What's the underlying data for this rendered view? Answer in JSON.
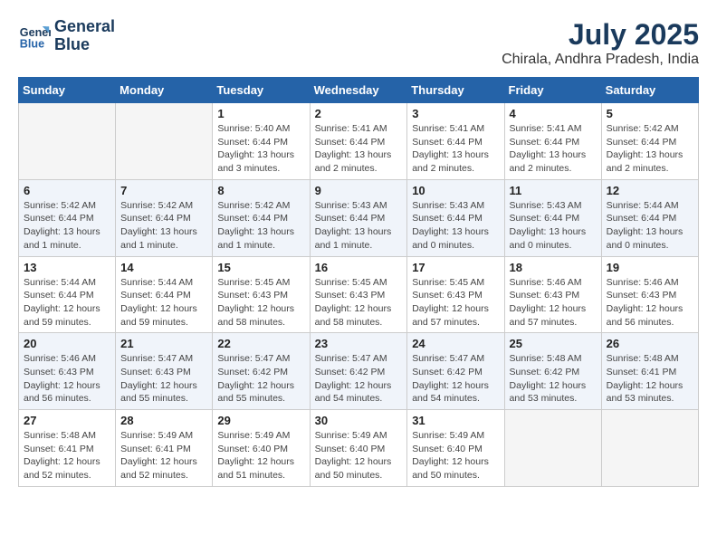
{
  "header": {
    "logo_line1": "General",
    "logo_line2": "Blue",
    "month_year": "July 2025",
    "location": "Chirala, Andhra Pradesh, India"
  },
  "weekdays": [
    "Sunday",
    "Monday",
    "Tuesday",
    "Wednesday",
    "Thursday",
    "Friday",
    "Saturday"
  ],
  "weeks": [
    [
      {
        "day": "",
        "empty": true
      },
      {
        "day": "",
        "empty": true
      },
      {
        "day": "1",
        "info": "Sunrise: 5:40 AM\nSunset: 6:44 PM\nDaylight: 13 hours and 3 minutes."
      },
      {
        "day": "2",
        "info": "Sunrise: 5:41 AM\nSunset: 6:44 PM\nDaylight: 13 hours and 2 minutes."
      },
      {
        "day": "3",
        "info": "Sunrise: 5:41 AM\nSunset: 6:44 PM\nDaylight: 13 hours and 2 minutes."
      },
      {
        "day": "4",
        "info": "Sunrise: 5:41 AM\nSunset: 6:44 PM\nDaylight: 13 hours and 2 minutes."
      },
      {
        "day": "5",
        "info": "Sunrise: 5:42 AM\nSunset: 6:44 PM\nDaylight: 13 hours and 2 minutes."
      }
    ],
    [
      {
        "day": "6",
        "info": "Sunrise: 5:42 AM\nSunset: 6:44 PM\nDaylight: 13 hours and 1 minute."
      },
      {
        "day": "7",
        "info": "Sunrise: 5:42 AM\nSunset: 6:44 PM\nDaylight: 13 hours and 1 minute."
      },
      {
        "day": "8",
        "info": "Sunrise: 5:42 AM\nSunset: 6:44 PM\nDaylight: 13 hours and 1 minute."
      },
      {
        "day": "9",
        "info": "Sunrise: 5:43 AM\nSunset: 6:44 PM\nDaylight: 13 hours and 1 minute."
      },
      {
        "day": "10",
        "info": "Sunrise: 5:43 AM\nSunset: 6:44 PM\nDaylight: 13 hours and 0 minutes."
      },
      {
        "day": "11",
        "info": "Sunrise: 5:43 AM\nSunset: 6:44 PM\nDaylight: 13 hours and 0 minutes."
      },
      {
        "day": "12",
        "info": "Sunrise: 5:44 AM\nSunset: 6:44 PM\nDaylight: 13 hours and 0 minutes."
      }
    ],
    [
      {
        "day": "13",
        "info": "Sunrise: 5:44 AM\nSunset: 6:44 PM\nDaylight: 12 hours and 59 minutes."
      },
      {
        "day": "14",
        "info": "Sunrise: 5:44 AM\nSunset: 6:44 PM\nDaylight: 12 hours and 59 minutes."
      },
      {
        "day": "15",
        "info": "Sunrise: 5:45 AM\nSunset: 6:43 PM\nDaylight: 12 hours and 58 minutes."
      },
      {
        "day": "16",
        "info": "Sunrise: 5:45 AM\nSunset: 6:43 PM\nDaylight: 12 hours and 58 minutes."
      },
      {
        "day": "17",
        "info": "Sunrise: 5:45 AM\nSunset: 6:43 PM\nDaylight: 12 hours and 57 minutes."
      },
      {
        "day": "18",
        "info": "Sunrise: 5:46 AM\nSunset: 6:43 PM\nDaylight: 12 hours and 57 minutes."
      },
      {
        "day": "19",
        "info": "Sunrise: 5:46 AM\nSunset: 6:43 PM\nDaylight: 12 hours and 56 minutes."
      }
    ],
    [
      {
        "day": "20",
        "info": "Sunrise: 5:46 AM\nSunset: 6:43 PM\nDaylight: 12 hours and 56 minutes."
      },
      {
        "day": "21",
        "info": "Sunrise: 5:47 AM\nSunset: 6:43 PM\nDaylight: 12 hours and 55 minutes."
      },
      {
        "day": "22",
        "info": "Sunrise: 5:47 AM\nSunset: 6:42 PM\nDaylight: 12 hours and 55 minutes."
      },
      {
        "day": "23",
        "info": "Sunrise: 5:47 AM\nSunset: 6:42 PM\nDaylight: 12 hours and 54 minutes."
      },
      {
        "day": "24",
        "info": "Sunrise: 5:47 AM\nSunset: 6:42 PM\nDaylight: 12 hours and 54 minutes."
      },
      {
        "day": "25",
        "info": "Sunrise: 5:48 AM\nSunset: 6:42 PM\nDaylight: 12 hours and 53 minutes."
      },
      {
        "day": "26",
        "info": "Sunrise: 5:48 AM\nSunset: 6:41 PM\nDaylight: 12 hours and 53 minutes."
      }
    ],
    [
      {
        "day": "27",
        "info": "Sunrise: 5:48 AM\nSunset: 6:41 PM\nDaylight: 12 hours and 52 minutes."
      },
      {
        "day": "28",
        "info": "Sunrise: 5:49 AM\nSunset: 6:41 PM\nDaylight: 12 hours and 52 minutes."
      },
      {
        "day": "29",
        "info": "Sunrise: 5:49 AM\nSunset: 6:40 PM\nDaylight: 12 hours and 51 minutes."
      },
      {
        "day": "30",
        "info": "Sunrise: 5:49 AM\nSunset: 6:40 PM\nDaylight: 12 hours and 50 minutes."
      },
      {
        "day": "31",
        "info": "Sunrise: 5:49 AM\nSunset: 6:40 PM\nDaylight: 12 hours and 50 minutes."
      },
      {
        "day": "",
        "empty": true
      },
      {
        "day": "",
        "empty": true
      }
    ]
  ]
}
